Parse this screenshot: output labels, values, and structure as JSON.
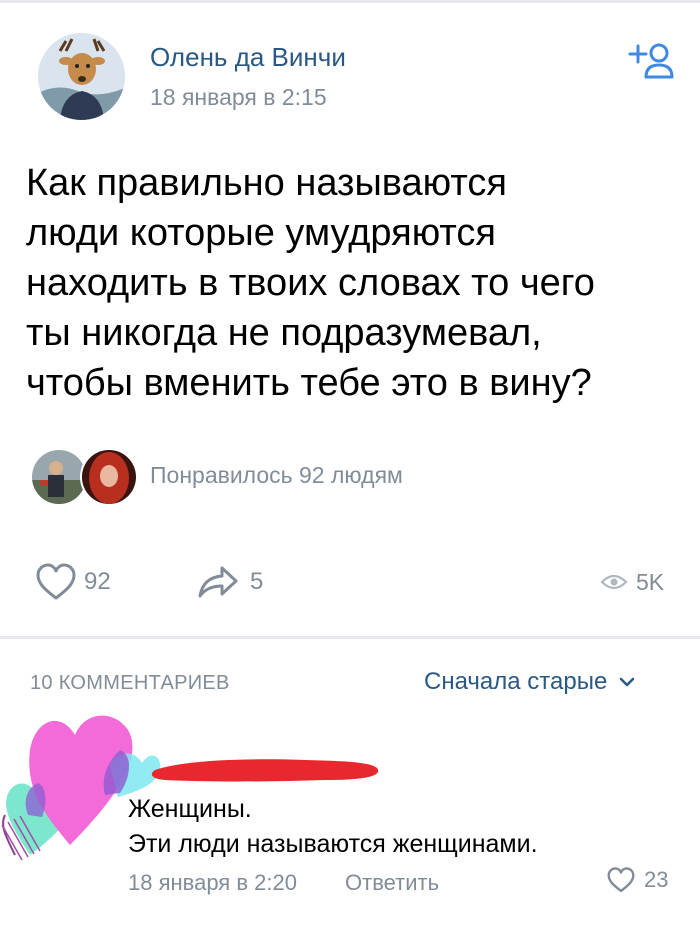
{
  "post": {
    "author": "Олень да Винчи",
    "date": "18 января в 2:15",
    "text": "Как правильно называются\nлюди которые умудряются\nнаходить в твоих словах то чего\nты никогда не подразумевал,\nчтобы вменить тебе это в вину?",
    "likes_text": "Понравилось 92 людям",
    "like_count": "92",
    "share_count": "5",
    "views": "5K"
  },
  "comments": {
    "count_label": "10 КОММЕНТАРИЕВ",
    "sort_label": "Сначала старые",
    "items": [
      {
        "text": "Женщины.\nЭти люди называются женщинами.",
        "date": "18 января в 2:20",
        "reply_label": "Ответить",
        "likes": "23"
      }
    ]
  },
  "colors": {
    "link": "#2a5885",
    "secondary": "#818c99",
    "divider": "#e7e8ec",
    "redaction": "#e8272e"
  },
  "icons": [
    "add-friend-icon",
    "heart-icon",
    "share-icon",
    "eye-icon",
    "chevron-down-icon"
  ]
}
